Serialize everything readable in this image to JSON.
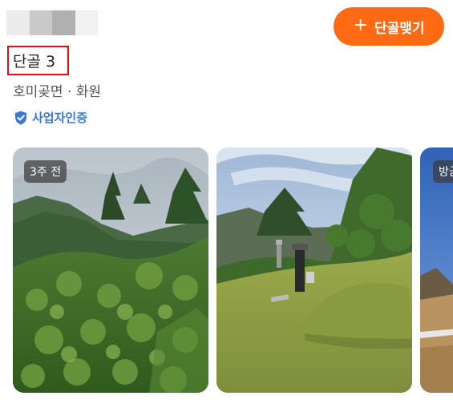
{
  "header": {
    "subscribe_label": "단골맺기",
    "plus_glyph": "+"
  },
  "profile": {
    "title": "단골 3",
    "location": "호미곶면 · 화원",
    "verified_label": "사업자인증"
  },
  "photos": [
    {
      "badge": "3주 전"
    },
    {
      "badge": ""
    },
    {
      "badge": "방금"
    }
  ],
  "colors": {
    "accent": "#ff6a13",
    "verified": "#3a78d8",
    "highlight_border": "#e01010"
  },
  "icons": {
    "verified": "shield-check-icon",
    "add": "plus-icon"
  }
}
